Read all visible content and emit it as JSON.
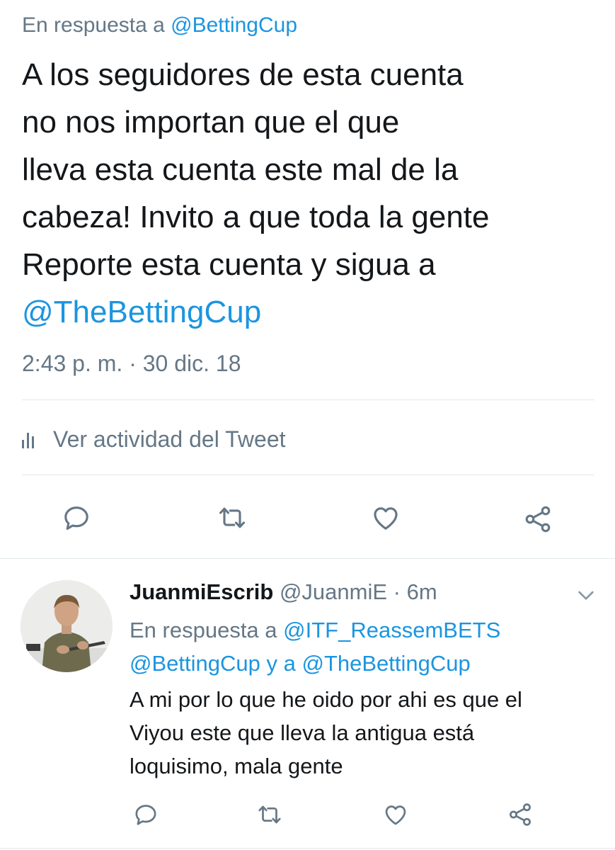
{
  "main_tweet": {
    "reply_prefix": "En respuesta a",
    "reply_handle": "@BettingCup",
    "text_lines": [
      "A los seguidores de esta cuenta",
      "no nos importan que el que",
      "lleva esta cuenta este mal de la",
      "cabeza! Invito a que toda la gente",
      "Reporte esta cuenta y sigua a"
    ],
    "mention": "@TheBettingCup",
    "timestamp": "2:43 p. m. · 30 dic. 18",
    "activity_label": "Ver actividad del Tweet",
    "actions": [
      "reply-icon",
      "retweet-icon",
      "like-icon",
      "share-icon"
    ]
  },
  "reply_tweet": {
    "name": "JuanmiEscrib",
    "handle": "@JuanmiE",
    "separator": "·",
    "time": "6m",
    "reply_prefix": "En respuesta a",
    "reply_handle_1": "@ITF_ReassemBETS",
    "reply_handle_2": "@BettingCup",
    "reply_conjunction": "y a",
    "reply_handle_3": "@TheBettingCup",
    "text_lines": [
      "A mi por lo que he oido por ahi es que el",
      "Viyou este que lleva la antigua está",
      "loquisimo, mala gente"
    ]
  },
  "colors": {
    "link": "#1b95e0",
    "secondary_text": "#657786",
    "divider": "#e1e8ed"
  }
}
